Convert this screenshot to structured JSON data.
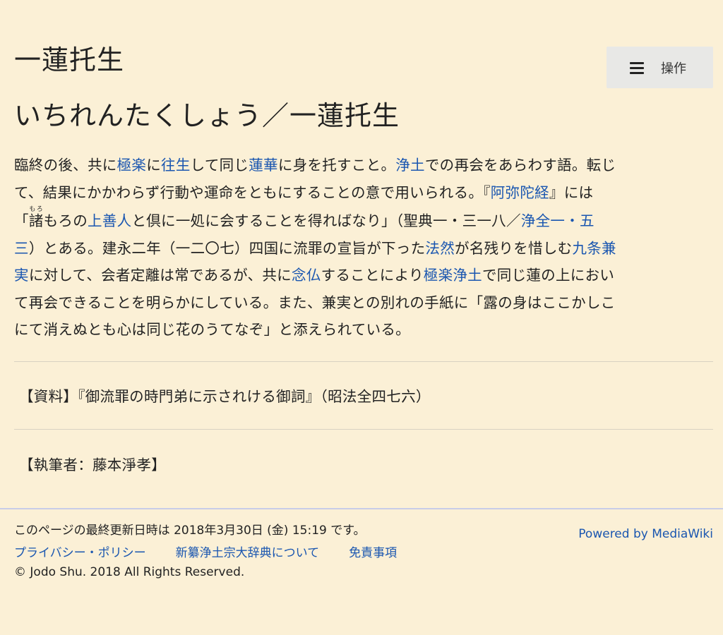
{
  "page": {
    "title": "一蓮托生",
    "actions_label": "操作",
    "heading": "いちれんたくしょう／一蓮托生"
  },
  "article": {
    "lines": [
      [
        {
          "t": "臨終の後、共に"
        },
        {
          "t": "極楽",
          "link": true
        },
        {
          "t": "に"
        },
        {
          "t": "往生",
          "link": true
        },
        {
          "t": "して同じ"
        },
        {
          "t": "蓮華",
          "link": true
        },
        {
          "t": "に身を托すこと。"
        },
        {
          "t": "浄土",
          "link": true
        },
        {
          "t": "での再会をあらわす語。転じ"
        }
      ],
      [
        {
          "t": "て、結果にかかわらず行動や運命をともにすることの意で用いられる。『"
        },
        {
          "t": "阿弥陀経",
          "link": true
        },
        {
          "t": "』には"
        }
      ],
      [
        {
          "t": "「"
        },
        {
          "t": "諸",
          "ruby": "もろ"
        },
        {
          "t": "もろの"
        },
        {
          "t": "上善人",
          "link": true
        },
        {
          "t": "と倶に一処に会することを得ればなり」（聖典一・三一八／"
        },
        {
          "t": "浄全一・五",
          "link": true
        }
      ],
      [
        {
          "t": "三",
          "link": true
        },
        {
          "t": "）とある。建永二年（一二〇七）四国に流罪の宣旨が下った"
        },
        {
          "t": "法然",
          "link": true
        },
        {
          "t": "が名残りを惜しむ"
        },
        {
          "t": "九条兼",
          "link": true
        }
      ],
      [
        {
          "t": "実",
          "link": true
        },
        {
          "t": "に対して、会者定離は常であるが、共に"
        },
        {
          "t": "念仏",
          "link": true
        },
        {
          "t": "することにより"
        },
        {
          "t": "極楽浄土",
          "link": true
        },
        {
          "t": "で同じ蓮の上におい"
        }
      ],
      [
        {
          "t": "て再会できることを明らかにしている。また、兼実との別れの手紙に「露の身はここかしこ"
        }
      ],
      [
        {
          "t": "にて消えぬとも心は同じ花のうてなぞ」と添えられている。"
        }
      ]
    ],
    "source": "【資料】『御流罪の時門弟に示されける御詞』（昭法全四七六）",
    "author": "【執筆者：藤本淨孝】"
  },
  "footer": {
    "last_modified": "このページの最終更新日時は 2018年3月30日 (金) 15:19 です。",
    "links": [
      "プライバシー・ポリシー",
      "新纂浄土宗大辞典について",
      "免責事項"
    ],
    "copyright": "© Jodo Shu. 2018 All Rights Reserved.",
    "powered_by": "Powered by MediaWiki"
  },
  "colors": {
    "background": "#fbf0d6",
    "link": "#1a56b0",
    "button": "#e8e8e6"
  },
  "icons": {
    "actions": "hamburger-menu-icon"
  }
}
